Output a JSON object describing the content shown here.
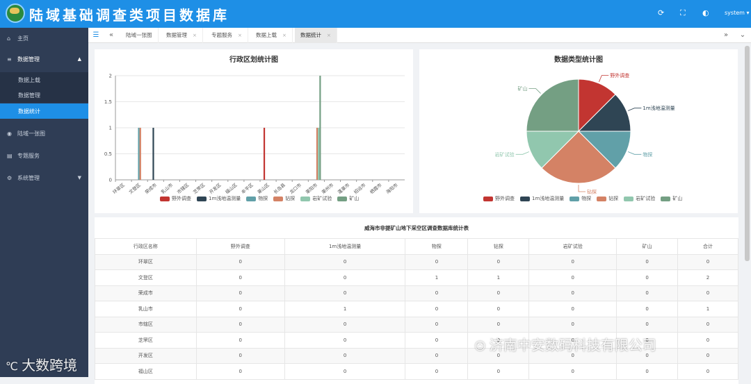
{
  "header": {
    "title": "陆域基础调查类项目数据库",
    "user": "system",
    "icons": [
      "refresh-icon",
      "fullscreen-icon",
      "theme-icon"
    ]
  },
  "sidebar": {
    "items": [
      {
        "label": "主页",
        "icon": "home-icon"
      },
      {
        "label": "数据管理",
        "icon": "data-icon",
        "expanded": true
      },
      {
        "label": "陆域一张图",
        "icon": "map-icon"
      },
      {
        "label": "专题服务",
        "icon": "service-icon"
      },
      {
        "label": "系统管理",
        "icon": "settings-icon"
      }
    ],
    "subitems": [
      {
        "label": "数据上载"
      },
      {
        "label": "数据管理"
      },
      {
        "label": "数据统计",
        "active": true
      }
    ]
  },
  "tabs": [
    {
      "label": "陆域一张图"
    },
    {
      "label": "数据管理"
    },
    {
      "label": "专题服务"
    },
    {
      "label": "数据上载"
    },
    {
      "label": "数据统计",
      "active": true
    }
  ],
  "bar_chart": {
    "title": "行政区划统计图",
    "chart_data": {
      "type": "bar",
      "categories": [
        "环翠区",
        "文登区",
        "荣成市",
        "乳山市",
        "市辖区",
        "芝罘区",
        "开发区",
        "福山区",
        "牟平区",
        "莱山区",
        "长岛县",
        "龙口市",
        "莱阳市",
        "莱州市",
        "蓬莱市",
        "招远市",
        "栖霞市",
        "海阳市"
      ],
      "series": [
        {
          "name": "野外调查",
          "color": "#c23531",
          "values": [
            0,
            0,
            0,
            0,
            0,
            0,
            0,
            0,
            0,
            1,
            0,
            0,
            0,
            0,
            0,
            0,
            0,
            0
          ]
        },
        {
          "name": "1m浅地温测量",
          "color": "#2f4554",
          "values": [
            0,
            0,
            1,
            0,
            0,
            0,
            0,
            0,
            0,
            0,
            0,
            0,
            0,
            0,
            0,
            0,
            0,
            0
          ]
        },
        {
          "name": "物探",
          "color": "#61a0a8",
          "values": [
            0,
            1,
            0,
            0,
            0,
            0,
            0,
            0,
            0,
            0,
            0,
            0,
            0,
            0,
            0,
            0,
            0,
            0
          ]
        },
        {
          "name": "钻探",
          "color": "#d48265",
          "values": [
            0,
            1,
            0,
            0,
            0,
            0,
            0,
            0,
            0,
            0,
            0,
            0,
            1,
            0,
            0,
            0,
            0,
            0
          ]
        },
        {
          "name": "岩矿试验",
          "color": "#91c7ae",
          "values": [
            0,
            0,
            0,
            0,
            0,
            0,
            0,
            0,
            0,
            0,
            0,
            0,
            1,
            0,
            0,
            0,
            0,
            0
          ]
        },
        {
          "name": "矿山",
          "color": "#749f83",
          "values": [
            0,
            0,
            0,
            0,
            0,
            0,
            0,
            0,
            0,
            0,
            0,
            0,
            2,
            0,
            0,
            0,
            0,
            0
          ]
        }
      ],
      "ylim": [
        0,
        2
      ],
      "yticks": [
        "0",
        "0.5",
        "1",
        "1.5",
        "2"
      ],
      "grid": true,
      "legend": "bottom"
    }
  },
  "pie_chart": {
    "title": "数据类型统计图",
    "chart_data": {
      "type": "pie",
      "slices": [
        {
          "name": "野外调查",
          "value": 1,
          "color": "#c23531"
        },
        {
          "name": "1m浅地温测量",
          "value": 1,
          "color": "#2f4554"
        },
        {
          "name": "物探",
          "value": 1,
          "color": "#61a0a8"
        },
        {
          "name": "钻探",
          "value": 2,
          "color": "#d48265"
        },
        {
          "name": "岩矿试验",
          "value": 1,
          "color": "#91c7ae"
        },
        {
          "name": "矿山",
          "value": 2,
          "color": "#749f83"
        }
      ],
      "legend": "bottom"
    }
  },
  "table": {
    "title": "威海市非提矿山地下采空区调查数据库统计表",
    "headers": [
      "行政区名称",
      "野外调查",
      "1m浅地温测量",
      "物探",
      "钻探",
      "岩矿试验",
      "矿山",
      "合计"
    ],
    "rows": [
      [
        "环翠区",
        "0",
        "0",
        "0",
        "0",
        "0",
        "0",
        "0"
      ],
      [
        "文登区",
        "0",
        "0",
        "1",
        "1",
        "0",
        "0",
        "2"
      ],
      [
        "荣成市",
        "0",
        "0",
        "0",
        "0",
        "0",
        "0",
        "0"
      ],
      [
        "乳山市",
        "0",
        "1",
        "0",
        "0",
        "0",
        "0",
        "1"
      ],
      [
        "市辖区",
        "0",
        "0",
        "0",
        "0",
        "0",
        "0",
        "0"
      ],
      [
        "芝罘区",
        "0",
        "0",
        "0",
        "0",
        "0",
        "0",
        "0"
      ],
      [
        "开发区",
        "0",
        "0",
        "0",
        "0",
        "0",
        "0",
        "0"
      ],
      [
        "福山区",
        "0",
        "0",
        "0",
        "0",
        "0",
        "0",
        "0"
      ]
    ]
  },
  "watermarks": {
    "left": "大数跨境",
    "right": "济南中安数码科技有限公司"
  }
}
